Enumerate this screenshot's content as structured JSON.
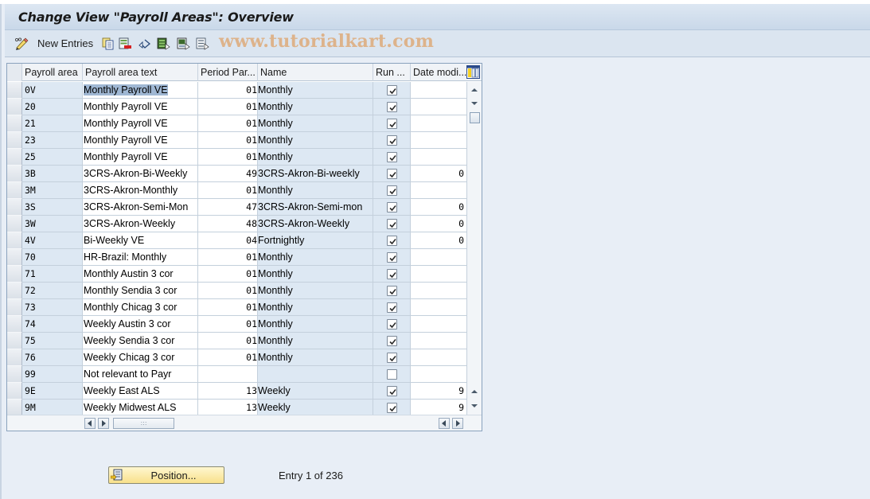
{
  "window": {
    "title": "Change View \"Payroll Areas\": Overview"
  },
  "toolbar": {
    "new_entries_label": "New Entries",
    "icons": [
      "edit-toggle-icon",
      "copy-as-icon",
      "delete-icon",
      "undo-change-icon",
      "select-all-icon",
      "select-block-icon",
      "deselect-all-icon"
    ]
  },
  "watermark": "www.tutorialkart.com",
  "table": {
    "columns": [
      {
        "key": "payroll_area",
        "label": "Payroll area"
      },
      {
        "key": "text",
        "label": "Payroll area text"
      },
      {
        "key": "period_param",
        "label": "Period Par..."
      },
      {
        "key": "name",
        "label": "Name"
      },
      {
        "key": "run",
        "label": "Run ..."
      },
      {
        "key": "date_mod",
        "label": "Date modi..."
      }
    ],
    "rows": [
      {
        "area": "0V",
        "text": "Monthly Payroll  VE",
        "period": "01",
        "name": "Monthly",
        "run": true,
        "date": "",
        "selected": true
      },
      {
        "area": "20",
        "text": "Monthly Payroll  VE",
        "period": "01",
        "name": "Monthly",
        "run": true,
        "date": ""
      },
      {
        "area": "21",
        "text": "Monthly Payroll  VE",
        "period": "01",
        "name": "Monthly",
        "run": true,
        "date": ""
      },
      {
        "area": "23",
        "text": "Monthly Payroll  VE",
        "period": "01",
        "name": "Monthly",
        "run": true,
        "date": ""
      },
      {
        "area": "25",
        "text": "Monthly Payroll  VE",
        "period": "01",
        "name": "Monthly",
        "run": true,
        "date": ""
      },
      {
        "area": "3B",
        "text": "3CRS-Akron-Bi-Weekly",
        "period": "49",
        "name": "3CRS-Akron-Bi-weekly",
        "run": true,
        "date": "0"
      },
      {
        "area": "3M",
        "text": "3CRS-Akron-Monthly",
        "period": "01",
        "name": "Monthly",
        "run": true,
        "date": ""
      },
      {
        "area": "3S",
        "text": "3CRS-Akron-Semi-Mon",
        "period": "47",
        "name": "3CRS-Akron-Semi-mon",
        "run": true,
        "date": "0"
      },
      {
        "area": "3W",
        "text": "3CRS-Akron-Weekly",
        "period": "48",
        "name": "3CRS-Akron-Weekly",
        "run": true,
        "date": "0"
      },
      {
        "area": "4V",
        "text": "Bi-Weekly VE",
        "period": "04",
        "name": "Fortnightly",
        "run": true,
        "date": "0"
      },
      {
        "area": "70",
        "text": "HR-Brazil: Monthly",
        "period": "01",
        "name": "Monthly",
        "run": true,
        "date": ""
      },
      {
        "area": "71",
        "text": "Monthly Austin 3 cor",
        "period": "01",
        "name": "Monthly",
        "run": true,
        "date": ""
      },
      {
        "area": "72",
        "text": "Monthly Sendia 3 cor",
        "period": "01",
        "name": "Monthly",
        "run": true,
        "date": ""
      },
      {
        "area": "73",
        "text": "Monthly Chicag 3 cor",
        "period": "01",
        "name": "Monthly",
        "run": true,
        "date": ""
      },
      {
        "area": "74",
        "text": "Weekly Austin 3 cor",
        "period": "01",
        "name": "Monthly",
        "run": true,
        "date": ""
      },
      {
        "area": "75",
        "text": "Weekly Sendia 3 cor",
        "period": "01",
        "name": "Monthly",
        "run": true,
        "date": ""
      },
      {
        "area": "76",
        "text": "Weekly Chicag 3 cor",
        "period": "01",
        "name": "Monthly",
        "run": true,
        "date": ""
      },
      {
        "area": "99",
        "text": "Not relevant to Payr",
        "period": "",
        "name": "",
        "run": false,
        "date": ""
      },
      {
        "area": "9E",
        "text": "Weekly East ALS",
        "period": "13",
        "name": "Weekly",
        "run": true,
        "date": "9"
      },
      {
        "area": "9M",
        "text": "Weekly Midwest ALS",
        "period": "13",
        "name": "Weekly",
        "run": true,
        "date": "9"
      }
    ]
  },
  "footer": {
    "position_button_label": "Position...",
    "entry_info": "Entry 1 of 236"
  },
  "colors": {
    "key_column_bg": "#dde8f3",
    "selection_highlight": "#9fb7d3",
    "position_button": "#f8e08a"
  }
}
